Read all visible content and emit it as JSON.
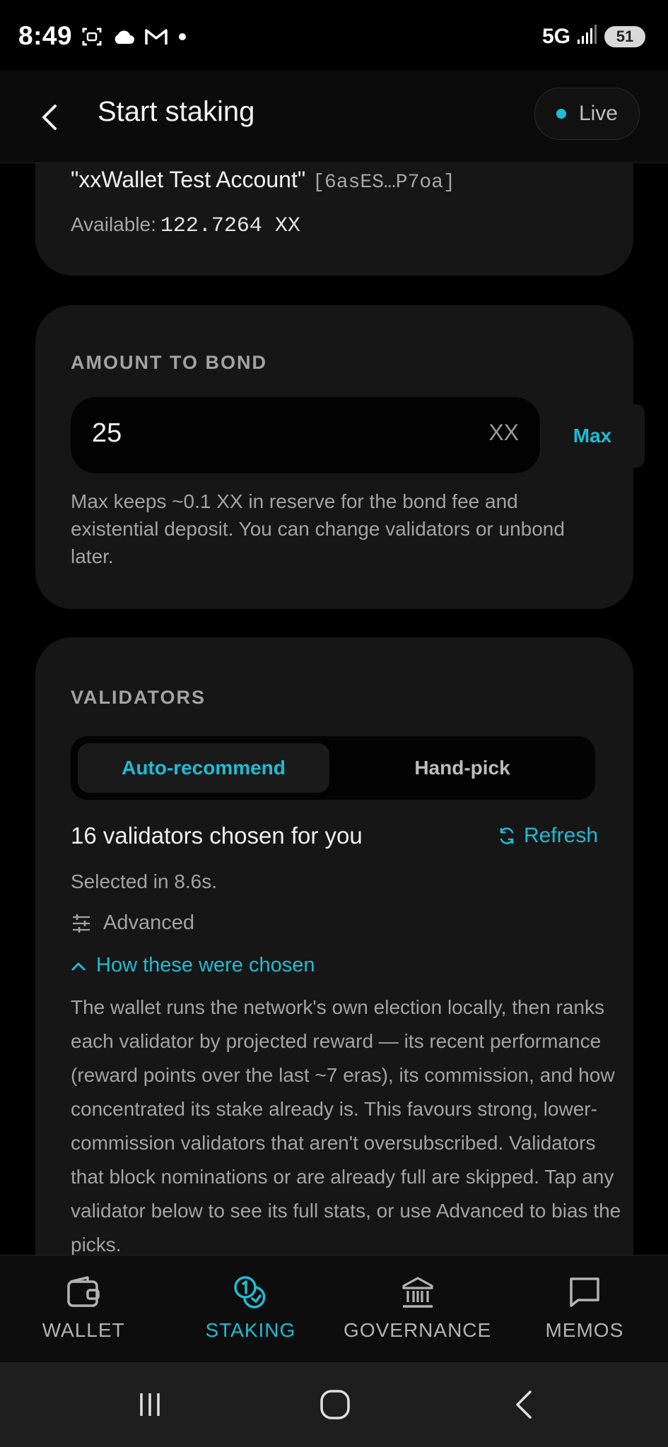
{
  "status_bar": {
    "time": "8:49",
    "network": "5G",
    "battery": "51"
  },
  "header": {
    "title": "Start staking",
    "live_label": "Live"
  },
  "account": {
    "name": "\"xxWallet Test Account\"",
    "address": "[6asES…P7oa]",
    "available_label": "Available:",
    "available_value": "122.7264 XX"
  },
  "bond": {
    "section_label": "AMOUNT TO BOND",
    "amount": "25",
    "unit": "XX",
    "max_label": "Max",
    "help_text": "Max keeps ~0.1 XX in reserve for the bond fee and existential deposit. You can change validators or unbond later."
  },
  "validators": {
    "section_label": "VALIDATORS",
    "tabs": [
      {
        "label": "Auto-recommend",
        "active": true
      },
      {
        "label": "Hand-pick",
        "active": false
      }
    ],
    "count_text": "16 validators chosen for you",
    "refresh_label": "Refresh",
    "selected_in": "Selected in 8.6s.",
    "advanced_label": "Advanced",
    "how_label": "How these were chosen",
    "explanation": "The wallet runs the network's own election locally, then ranks each validator by projected reward — its recent performance (reward points over the last ~7 eras), its commission, and how concentrated its stake already is. This favours strong, lower-commission validators that aren't oversubscribed. Validators that block nominations or are already full are skipped. Tap any validator below to see its full stats, or use Advanced to bias the picks."
  },
  "bottom_nav": {
    "items": [
      {
        "label": "WALLET",
        "icon": "wallet-icon"
      },
      {
        "label": "STAKING",
        "icon": "staking-coins-icon"
      },
      {
        "label": "GOVERNANCE",
        "icon": "bank-icon"
      },
      {
        "label": "MEMOS",
        "icon": "chat-bubble-icon"
      }
    ],
    "active_index": 1
  },
  "colors": {
    "accent": "#1fbcd3",
    "background": "#000000",
    "card": "#161616"
  }
}
